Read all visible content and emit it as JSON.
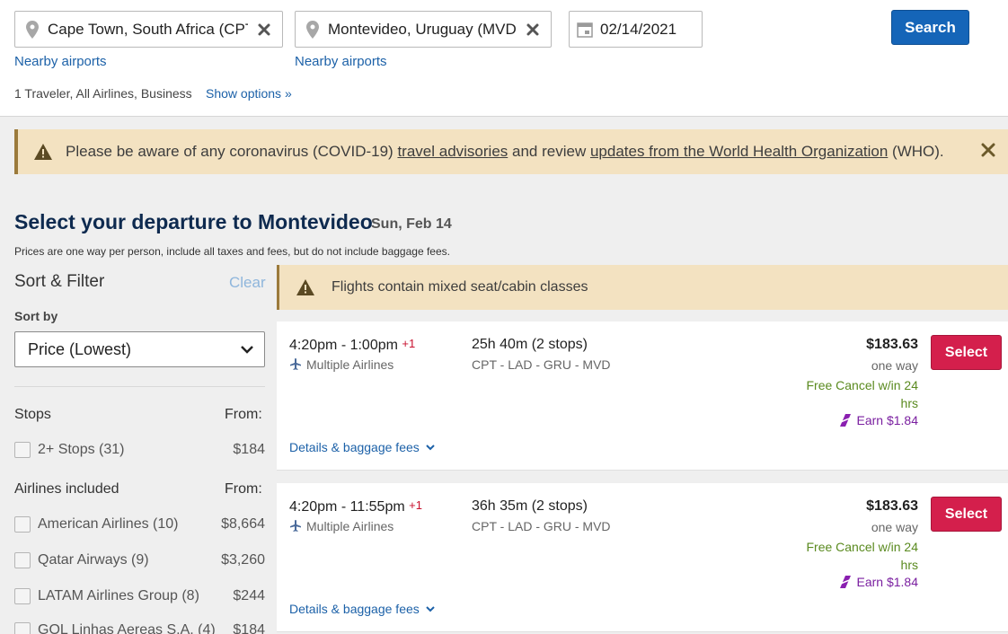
{
  "search": {
    "origin": "Cape Town, South Africa (CPT)",
    "destination": "Montevideo, Uruguay (MVD)",
    "date": "02/14/2021",
    "nearby_label": "Nearby airports",
    "search_label": "Search",
    "travelers": "1 Traveler, All Airlines, Business",
    "show_options": "Show options »"
  },
  "banner": {
    "pre": "Please be aware of any coronavirus (COVID-19) ",
    "link1": "travel advisories",
    "mid": " and review ",
    "link2": "updates from the World Health Organization",
    "post": " (WHO)."
  },
  "heading": {
    "title": "Select your departure to Montevideo",
    "date": "Sun, Feb 14",
    "note": "Prices are one way per person, include all taxes and fees, but do not include baggage fees."
  },
  "sidebar": {
    "title": "Sort & Filter",
    "clear": "Clear",
    "sort_by": "Sort by",
    "sort_value": "Price (Lowest)",
    "stops_title": "Stops",
    "from_label": "From:",
    "stops": [
      {
        "label": "2+ Stops (31)",
        "price": "$184"
      }
    ],
    "airlines_title": "Airlines included",
    "airlines": [
      {
        "label": "American Airlines (10)",
        "price": "$8,664"
      },
      {
        "label": "Qatar Airways (9)",
        "price": "$3,260"
      },
      {
        "label": "LATAM Airlines Group (8)",
        "price": "$244"
      },
      {
        "label": "GOL Linhas Aereas S.A. (4)",
        "price": "$184"
      }
    ]
  },
  "notice": "Flights contain mixed seat/cabin classes",
  "flights": [
    {
      "times": "4:20pm - 1:00pm",
      "plus": "+1",
      "airline": "Multiple Airlines",
      "duration": "25h 40m (2 stops)",
      "route": "CPT - LAD - GRU - MVD",
      "price": "$183.63",
      "oneway": "one way",
      "cancel": "Free Cancel w/in 24 hrs",
      "earn": "Earn $1.84",
      "select": "Select",
      "details": "Details & baggage fees"
    },
    {
      "times": "4:20pm - 11:55pm",
      "plus": "+1",
      "airline": "Multiple Airlines",
      "duration": "36h 35m (2 stops)",
      "route": "CPT - LAD - GRU - MVD",
      "price": "$183.63",
      "oneway": "one way",
      "cancel": "Free Cancel w/in 24 hrs",
      "earn": "Earn $1.84",
      "select": "Select",
      "details": "Details & baggage fees"
    }
  ],
  "colors": {
    "accent": "#1565b8",
    "select": "#d41f4c",
    "banner": "#f3e2c1",
    "cancel_green": "#5a8a1f",
    "loyalty_purple": "#7a1fa0"
  }
}
